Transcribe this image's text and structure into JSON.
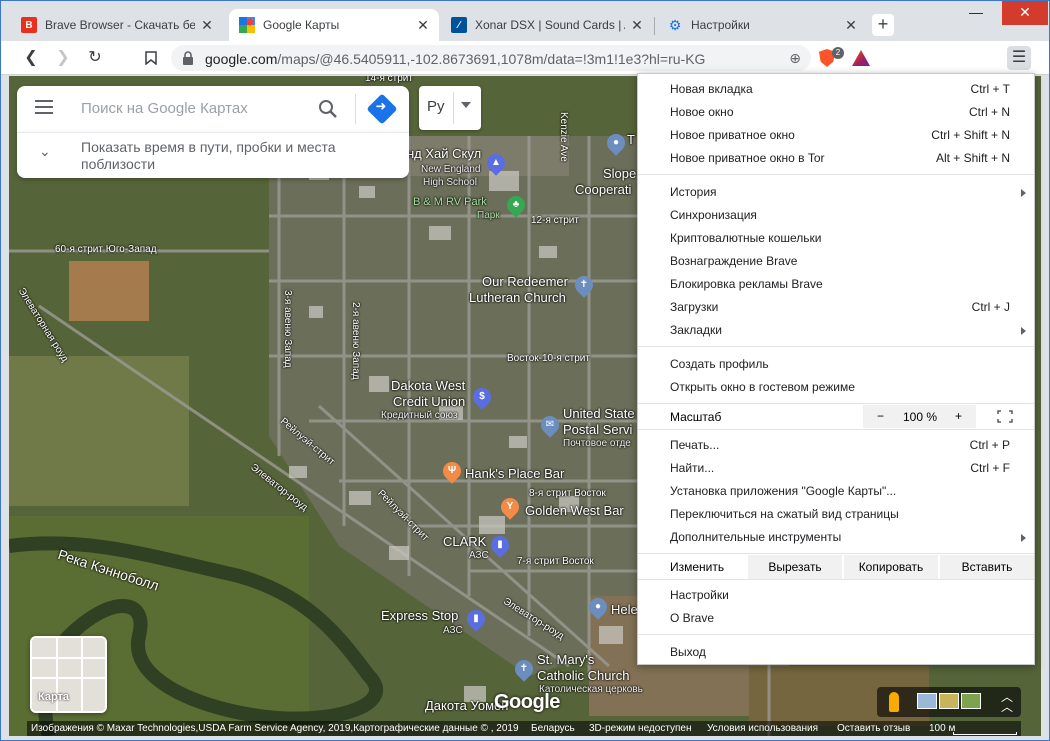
{
  "tabs": [
    {
      "title": "Brave Browser - Скачать бесп",
      "favicon": "brave-red-icon",
      "active": false
    },
    {
      "title": "Google Карты",
      "favicon": "google-maps-icon",
      "active": true
    },
    {
      "title": "Xonar DSX | Sound Cards | AS",
      "favicon": "asus-icon",
      "active": false
    },
    {
      "title": "Настройки",
      "favicon": "settings-gear-icon",
      "active": false
    }
  ],
  "window_controls": {
    "minimize": "—",
    "maximize": "☐",
    "close": "✕"
  },
  "toolbar": {
    "url_host": "google.com",
    "url_rest": "/maps/@46.5405911,-102.8673691,1078m/data=!3m1!1e3?hl=ru-KG",
    "shield_count": "2"
  },
  "maps": {
    "search_placeholder": "Поиск на Google Картах",
    "hint_text": "Показать время в пути, пробки и места поблизости",
    "language": "Ру",
    "layer_label": "Карта",
    "google_logo": "Google",
    "attribution": {
      "imagery": "Изображения © Maxar Technologies,USDA Farm Service Agency, 2019,Картографические данные © , 2019",
      "country": "Беларусь",
      "mode_3d": "3D-режим недоступен",
      "terms": "Условия использования",
      "feedback": "Оставить отзыв",
      "scale": "100 м"
    },
    "labels": {
      "street_14": "14-я стрит",
      "school": "нд Хай Скул",
      "school_sub1": "New England",
      "school_sub2": "High School",
      "rv_park": "B & M RV Park",
      "park": "Парк",
      "street_12": "12-я стрит",
      "street_60": "60-я стрит Юго-Запад",
      "elevator_road": "Элеваторная роуд",
      "ave_3": "3-я авеню Запад",
      "ave_2": "2-я авеню Запад",
      "church1a": "Our Redeemer",
      "church1b": "Lutheran Church",
      "street_10": "Восток-10-я стрит",
      "bank1": "Dakota West",
      "bank2": "Credit Union",
      "bank_sub": "Кредитный союз",
      "railway1": "Рейлуэй-стрит",
      "usps1": "United State",
      "usps2": "Postal Servi",
      "usps_sub": "Почтовое отде",
      "hanks": "Hank's Place Bar",
      "elevator2": "Элеватор-роуд",
      "street_8": "8-я стрит Восток",
      "golden": "Golden West Bar",
      "railway2": "Рейлуэй-стрит",
      "clark": "CLARK",
      "azs": "АЗС",
      "street_7": "7-я стрит Восток",
      "river": "Река Кэнноболл",
      "express": "Express Stop",
      "azs2": "АЗС",
      "elevator3": "Элеватор-роуд",
      "helen": "Hele",
      "stmary1": "St. Mary's",
      "stmary2": "Catholic Church",
      "stmary_sub": "Католическая церковь",
      "dakota_south": "Дакота Уомен",
      "slope1": "Slope E",
      "slope2": "Cooperati",
      "kenzie": "Kenzie Ave",
      "t_letter": "T"
    }
  },
  "menu": {
    "items_group1": [
      {
        "label": "Новая вкладка",
        "shortcut": "Ctrl + T"
      },
      {
        "label": "Новое окно",
        "shortcut": "Ctrl + N"
      },
      {
        "label": "Новое приватное окно",
        "shortcut": "Ctrl + Shift + N"
      },
      {
        "label": "Новое приватное окно в Tor",
        "shortcut": "Alt + Shift + N"
      }
    ],
    "items_group2": [
      {
        "label": "История",
        "shortcut": ""
      },
      {
        "label": "Синхронизация",
        "shortcut": ""
      },
      {
        "label": "Криптовалютные кошельки",
        "shortcut": ""
      },
      {
        "label": "Вознаграждение Brave",
        "shortcut": ""
      },
      {
        "label": "Блокировка рекламы Brave",
        "shortcut": ""
      },
      {
        "label": "Загрузки",
        "shortcut": "Ctrl + J"
      },
      {
        "label": "Закладки",
        "shortcut": ""
      }
    ],
    "items_group3": [
      {
        "label": "Создать профиль",
        "shortcut": ""
      },
      {
        "label": "Открыть окно в гостевом режиме",
        "shortcut": ""
      }
    ],
    "zoom": {
      "label": "Масштаб",
      "minus": "−",
      "value": "100 %",
      "plus": "+"
    },
    "items_group4": [
      {
        "label": "Печать...",
        "shortcut": "Ctrl + P"
      },
      {
        "label": "Найти...",
        "shortcut": "Ctrl + F"
      },
      {
        "label": "Установка приложения \"Google Карты\"...",
        "shortcut": ""
      },
      {
        "label": "Переключиться на сжатый вид страницы",
        "shortcut": ""
      },
      {
        "label": "Дополнительные инструменты",
        "shortcut": ""
      }
    ],
    "edit": {
      "label": "Изменить",
      "cut": "Вырезать",
      "copy": "Копировать",
      "paste": "Вставить"
    },
    "items_group5": [
      {
        "label": "Настройки",
        "shortcut": ""
      },
      {
        "label": "О Brave",
        "shortcut": ""
      }
    ],
    "exit": {
      "label": "Выход"
    }
  }
}
